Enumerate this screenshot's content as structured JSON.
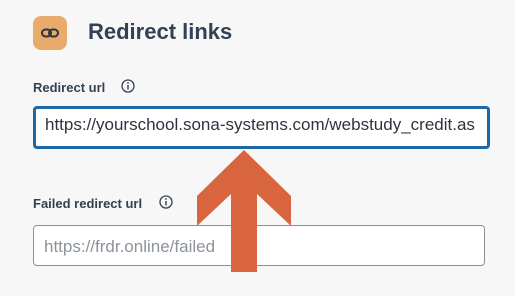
{
  "section": {
    "title": "Redirect links",
    "icon": "link-icon",
    "icon_bg": "#e8ab6b"
  },
  "redirect": {
    "label": "Redirect url",
    "info_icon": "info-icon",
    "value": "https://yourschool.sona-systems.com/webstudy_credit.as"
  },
  "failed_redirect": {
    "label": "Failed redirect url",
    "info_icon": "info-icon",
    "placeholder": "https://frdr.online/failed"
  },
  "annotation": {
    "arrow": "arrow-up-icon",
    "color": "#d9653e"
  },
  "colors": {
    "focus_border": "#1e68a6",
    "background": "#f7f7f8"
  }
}
